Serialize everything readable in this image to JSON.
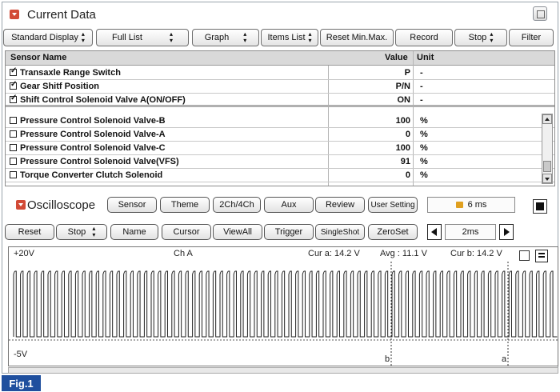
{
  "current_data": {
    "title": "Current Data",
    "toolbar": {
      "standard_display": "Standard Display",
      "full_list": "Full List",
      "graph": "Graph",
      "items_list": "Items List",
      "reset_minmax": "Reset Min.Max.",
      "record": "Record",
      "stop": "Stop",
      "filter": "Filter"
    },
    "columns": {
      "name": "Sensor Name",
      "value": "Value",
      "unit": "Unit"
    },
    "rows": [
      {
        "checked": true,
        "name": "Transaxle Range Switch",
        "value": "P",
        "unit": "-"
      },
      {
        "checked": true,
        "name": "Gear Shitf Position",
        "value": "P/N",
        "unit": "-"
      },
      {
        "checked": true,
        "name": "Shift Control Solenoid Valve A(ON/OFF)",
        "value": "ON",
        "unit": "-"
      },
      {
        "checked": false,
        "name": "Pressure Control Solenoid Valve-B",
        "value": "100",
        "unit": "%"
      },
      {
        "checked": false,
        "name": "Pressure Control Solenoid Valve-A",
        "value": "0",
        "unit": "%"
      },
      {
        "checked": false,
        "name": "Pressure Control Solenoid Valve-C",
        "value": "100",
        "unit": "%"
      },
      {
        "checked": false,
        "name": "Pressure Control Solenoid Valve(VFS)",
        "value": "91",
        "unit": "%"
      },
      {
        "checked": false,
        "name": "Torque Converter Clutch Solenoid",
        "value": "0",
        "unit": "%"
      }
    ]
  },
  "oscilloscope": {
    "title": "Oscilloscope",
    "buttons1": {
      "sensor": "Sensor",
      "theme": "Theme",
      "ch24": "2Ch/4Ch",
      "aux": "Aux",
      "review": "Review",
      "user_setting": "User Setting"
    },
    "time_display": "6 ms",
    "buttons2": {
      "reset": "Reset",
      "stop": "Stop",
      "name": "Name",
      "cursor": "Cursor",
      "viewall": "ViewAll",
      "trigger": "Trigger",
      "singleshot": "SingleShot",
      "zeroset": "ZeroSet"
    },
    "timebase": "2ms",
    "scope": {
      "top_label": "+20V",
      "bottom_label": "-5V",
      "channel": "Ch A",
      "cur_a": "Cur a:  14.2 V",
      "avg": "Avg :  11.1 V",
      "cur_b": "Cur b:  14.2 V",
      "cursor_b": "b",
      "cursor_a": "a"
    }
  },
  "figure_label": "Fig.1"
}
